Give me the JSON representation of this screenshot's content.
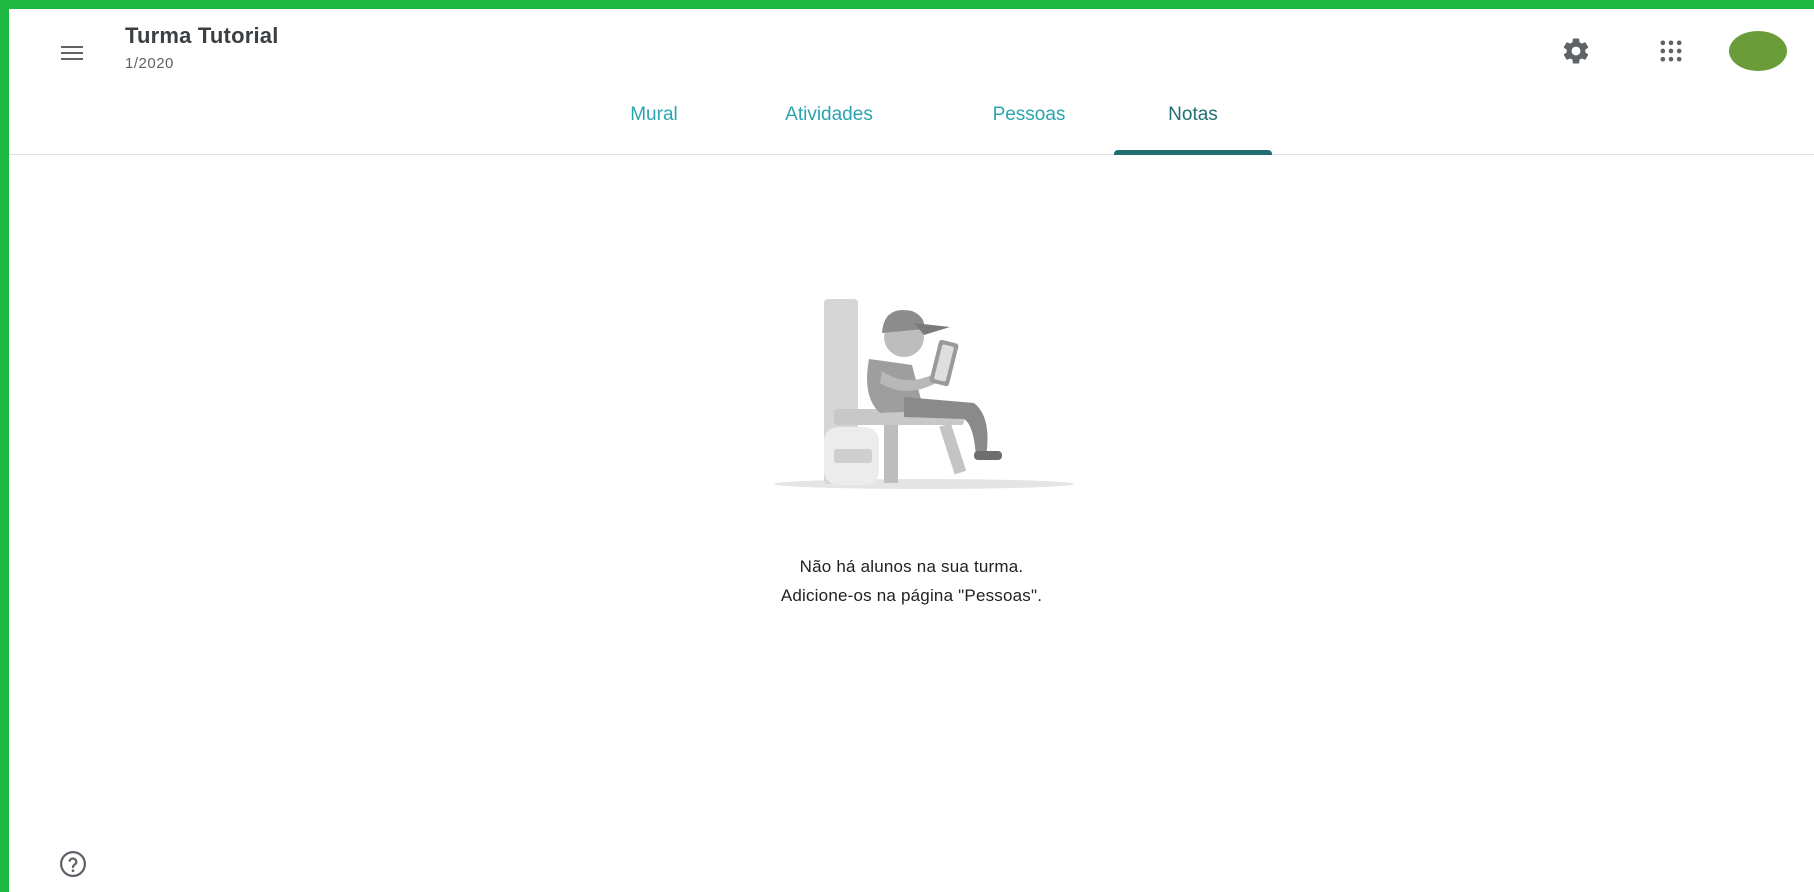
{
  "header": {
    "class_title": "Turma Tutorial",
    "class_subtitle": "1/2020",
    "icons": {
      "menu": "menu-icon",
      "settings": "gear-icon",
      "apps": "apps-grid-icon",
      "avatar": "avatar"
    }
  },
  "tabs": [
    {
      "label": "Mural",
      "selected": false
    },
    {
      "label": "Atividades",
      "selected": false
    },
    {
      "label": "Pessoas",
      "selected": false
    },
    {
      "label": "Notas",
      "selected": true
    }
  ],
  "empty_state": {
    "line1": "Não há alunos na sua turma.",
    "line2": "Adicione-os na página \"Pessoas\"."
  },
  "colors": {
    "frame_border": "#1db83f",
    "tab_text": "#2aa5b0",
    "tab_selected": "#1f6f73",
    "avatar": "#6a9d3a"
  },
  "footer": {
    "help_icon": "help-icon"
  }
}
